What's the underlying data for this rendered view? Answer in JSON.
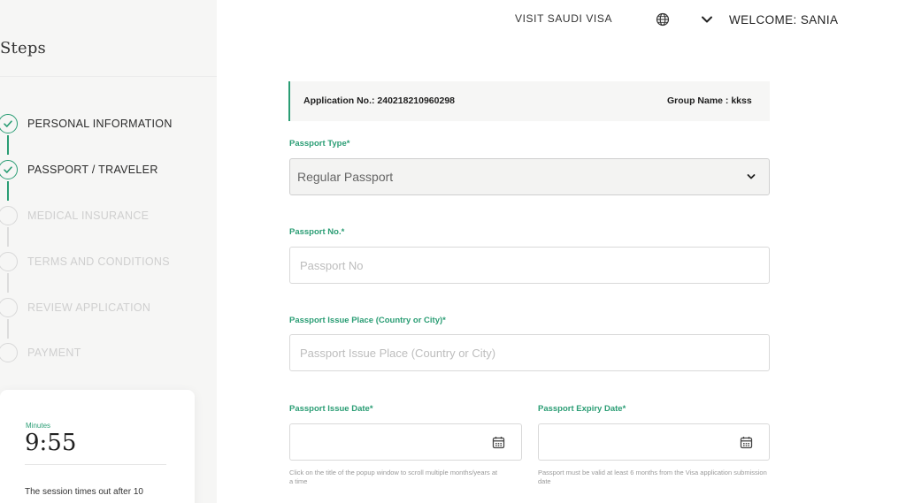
{
  "sidebar": {
    "title": "Steps",
    "steps": [
      {
        "label": "PERSONAL INFORMATION",
        "status": "done"
      },
      {
        "label": "PASSPORT / TRAVELER",
        "status": "done"
      },
      {
        "label": "MEDICAL INSURANCE",
        "status": "pending"
      },
      {
        "label": "TERMS AND CONDITIONS",
        "status": "pending"
      },
      {
        "label": "REVIEW APPLICATION",
        "status": "pending"
      },
      {
        "label": "PAYMENT",
        "status": "pending"
      }
    ],
    "timer": {
      "caption": "Minutes",
      "value": "9:55",
      "note": "The session times out after 10"
    }
  },
  "header": {
    "nav_link": "VISIT SAUDI VISA",
    "language_icon": "globe-icon",
    "welcome": "WELCOME: SANIA"
  },
  "application": {
    "number_text": "Application No.: 240218210960298",
    "group_text": "Group Name :  kkss"
  },
  "form": {
    "passport_type": {
      "label": "Passport Type*",
      "value": "Regular Passport"
    },
    "passport_no": {
      "label": "Passport No.*",
      "placeholder": "Passport No"
    },
    "issue_place": {
      "label": "Passport Issue Place (Country or City)*",
      "placeholder": "Passport Issue Place (Country or City)"
    },
    "issue_date": {
      "label": "Passport Issue Date*",
      "hint": "Click on the title of the popup window to scroll multiple months/years at a time"
    },
    "expiry_date": {
      "label": "Passport Expiry Date*",
      "hint": "Passport must be valid at least 6 months from the Visa application submission date"
    }
  },
  "colors": {
    "accent": "#2a9d74",
    "sidebar_bg": "#f6f6f5",
    "pending": "#cfcfcf"
  }
}
